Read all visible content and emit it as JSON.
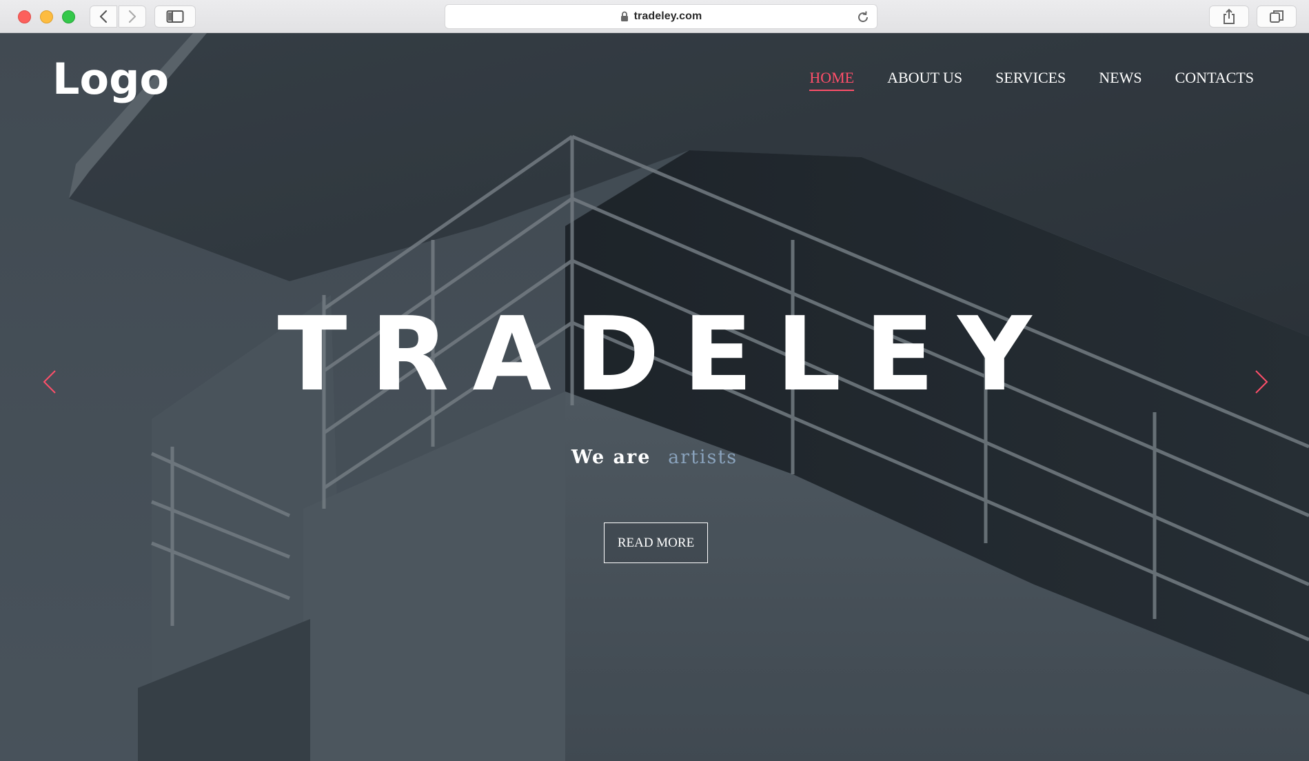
{
  "browser": {
    "url": "tradeley.com",
    "icons": [
      "back-icon",
      "forward-icon",
      "sidebar-icon",
      "lock-icon",
      "reload-icon",
      "share-icon",
      "tabs-icon"
    ]
  },
  "site": {
    "logo": "Logo",
    "nav": [
      {
        "label": "HOME",
        "active": true
      },
      {
        "label": "ABOUT US",
        "active": false
      },
      {
        "label": "SERVICES",
        "active": false
      },
      {
        "label": "NEWS",
        "active": false
      },
      {
        "label": "CONTACTS",
        "active": false
      }
    ],
    "hero": {
      "title": "TRADELEY",
      "tagline_lead": "We are",
      "tagline_accent": "artists",
      "cta": "READ MORE"
    },
    "slider_controls": [
      "prev-arrow-icon",
      "next-arrow-icon"
    ]
  },
  "colors": {
    "accent": "#ff4f6a",
    "tagline_accent": "#8aa3bd",
    "overlay": "#3f4a52"
  }
}
